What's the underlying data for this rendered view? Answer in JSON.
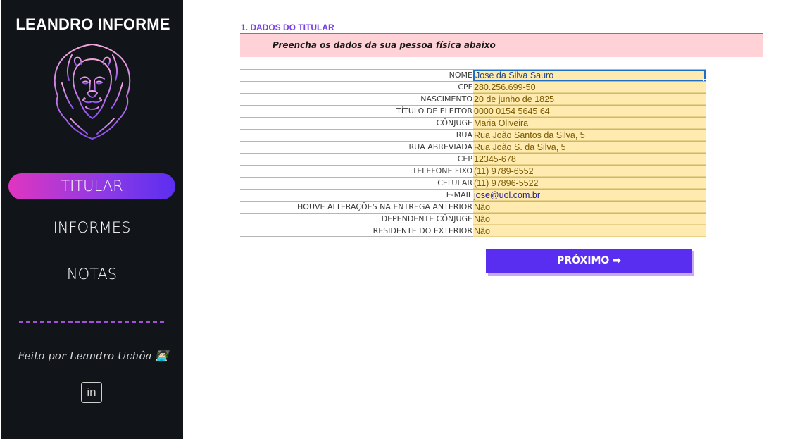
{
  "sidebar": {
    "brand": "LEANDRO INFORME",
    "logo_icon": "lion-head-icon",
    "nav": [
      {
        "label": "TITULAR",
        "active": true
      },
      {
        "label": "INFORMES",
        "active": false
      },
      {
        "label": "NOTAS",
        "active": false
      }
    ],
    "credit": "Feito por Leandro Uchôa 👨🏻‍💻",
    "linkedin_icon_text": "in"
  },
  "main": {
    "section_title": "1. DADOS DO TITULAR",
    "instruction": "Preencha os dados da sua pessoa física abaixo",
    "rows": [
      {
        "label": "NOME",
        "value": "Jose da Silva Sauro"
      },
      {
        "label": "CPF",
        "value": "280.256.699-50"
      },
      {
        "label": "NASCIMENTO",
        "value": "20 de junho de 1825"
      },
      {
        "label": "TÍTULO DE ELEITOR",
        "value": "0000 0154 5645 64"
      },
      {
        "label": "CÔNJUGE",
        "value": "Maria Oliveira"
      },
      {
        "label": "RUA",
        "value": "Rua João Santos da Silva, 5"
      },
      {
        "label": "RUA ABREVIADA",
        "value": "Rua João S. da Silva, 5"
      },
      {
        "label": "CEP",
        "value": "12345-678"
      },
      {
        "label": "TELEFONE FIXO",
        "value": "(11) 9789-6552"
      },
      {
        "label": "CELULAR",
        "value": "(11) 97896-5522"
      },
      {
        "label": "E-MAIL",
        "value": "jose@uol.com.br"
      },
      {
        "label": "HOUVE ALTERAÇÕES NA ENTREGA ANTERIOR",
        "value": "Não"
      },
      {
        "label": "DEPENDENTE CÔNJUGE",
        "value": "Não"
      },
      {
        "label": "RESIDENTE DO EXTERIOR",
        "value": "Não"
      }
    ],
    "next_button": "PRÓXIMO ➡"
  },
  "colors": {
    "sidebar_bg": "#111418",
    "accent_purple": "#5a2ef0",
    "accent_pink": "#e035c0",
    "instruction_band": "#ffd2d8",
    "input_fill": "#ffeab0"
  }
}
